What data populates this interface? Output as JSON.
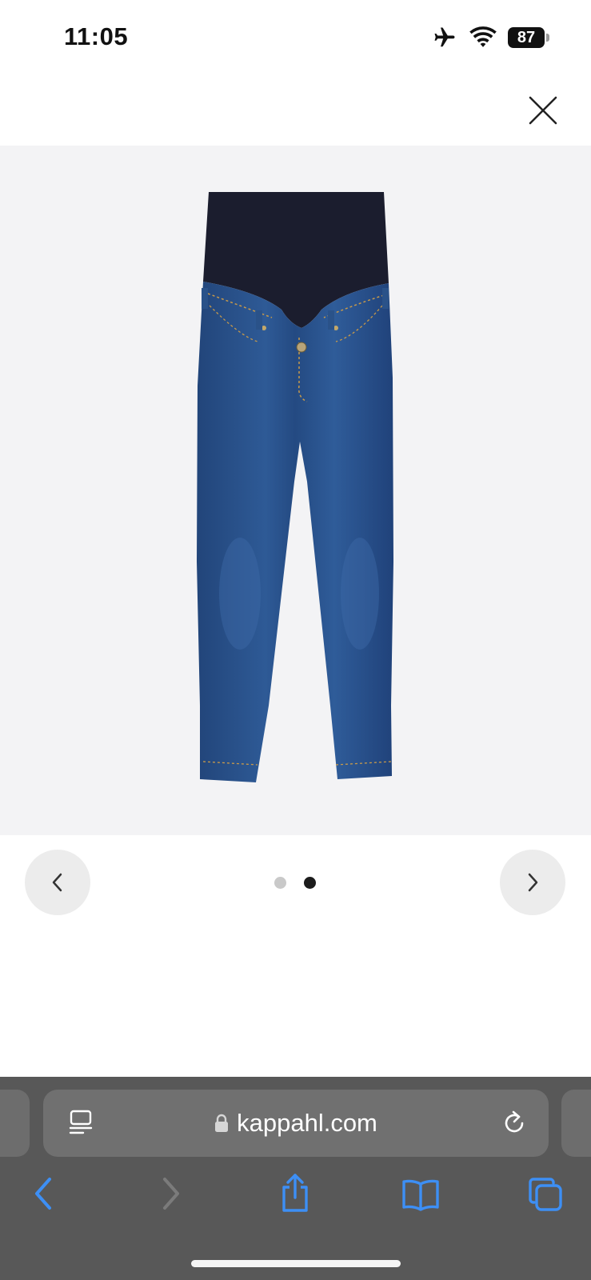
{
  "status_bar": {
    "time": "11:05",
    "battery_level": "87",
    "icons": [
      "airplane-icon",
      "wifi-icon",
      "battery-icon"
    ]
  },
  "modal": {
    "close_icon": "close-icon"
  },
  "gallery": {
    "current_image": 2,
    "total_images": 2,
    "prev_icon": "chevron-left-icon",
    "next_icon": "chevron-right-icon"
  },
  "browser": {
    "url": "kappahl.com",
    "icons": [
      "reader-icon",
      "lock-icon",
      "reload-icon"
    ],
    "toolbar": [
      "back-icon",
      "forward-icon",
      "share-icon",
      "bookmarks-icon",
      "tabs-icon"
    ]
  },
  "colors": {
    "accent": "#3d8ff5",
    "image_background": "#f3f3f5",
    "toolbar_background": "#585858",
    "denim": "#284f88",
    "waistband": "#1b1d2e"
  }
}
